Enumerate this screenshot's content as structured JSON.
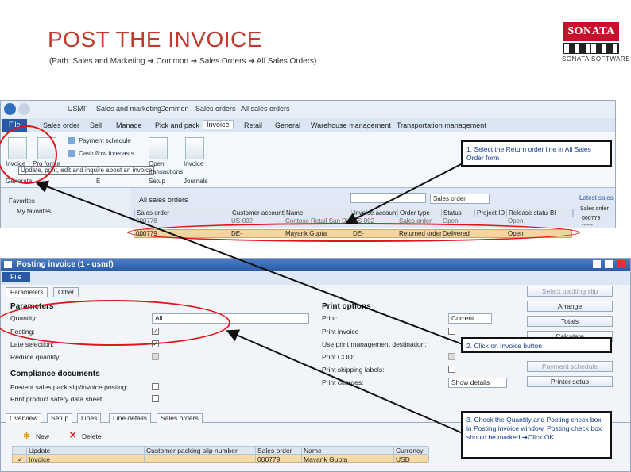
{
  "header": {
    "title": "POST THE INVOICE",
    "path_text": "(Path: Sales and Marketing ➔ Common ➔ Sales Orders ➔ All Sales Orders)"
  },
  "logo": {
    "name": "SONATA",
    "sub": "SONATA SOFTWARE"
  },
  "top_window": {
    "breadcrumb": [
      "USMF",
      "Sales and marketing",
      "Common",
      "Sales orders",
      "All sales orders"
    ],
    "ribbon_tabs": [
      "File",
      "Sales order",
      "Sell",
      "Manage",
      "Pick and pack",
      "Invoice",
      "Retail",
      "General",
      "Warehouse management",
      "Transportation management"
    ],
    "ribbon_buttons": {
      "invoice": "Invoice",
      "pro_forma": "Pro forma",
      "payment_schedule": "Payment schedule",
      "cash_flow": "Cash flow forecasts",
      "open_transactions": "Open transactions",
      "invoice_journal": "Invoice",
      "tooltip": "Update, print, edit and inquire about an invoice",
      "group_invoice": "Generate",
      "group_e": "E",
      "group_setup": "Setup",
      "group_journals": "Journals"
    },
    "nav": {
      "favorites": "Favorites",
      "my_favorites": "My favorites"
    },
    "list_title": "All sales orders",
    "filter_combo": "Sales order",
    "latest_sales": "Latest sales",
    "latest_sales_col": "Sales order",
    "latest_values": [
      "000779",
      "------"
    ],
    "columns": [
      "Sales order",
      "Customer account",
      "Name",
      "Invoice account",
      "Order type",
      "Status",
      "Project ID",
      "Release status",
      "Bl"
    ],
    "rows": [
      [
        "000778",
        "US-002",
        "Contoso Retail San Diego",
        "US-002",
        "Sales order",
        "Open",
        "",
        "Open",
        ""
      ],
      [
        "000779",
        "DE-",
        "Mayank Gupta",
        "DE-",
        "Returned order",
        "Delivered",
        "",
        "Open",
        ""
      ]
    ]
  },
  "posting_window": {
    "title": "Posting invoice (1 - usmf)",
    "menu_file": "File",
    "tabs": [
      "Parameters",
      "Other"
    ],
    "parameters": {
      "header": "Parameters",
      "quantity_label": "Quantity:",
      "quantity_value": "All",
      "posting_label": "Posting:",
      "late_selection_label": "Late selection:",
      "reduce_quantity_label": "Reduce quantity"
    },
    "compliance": {
      "header": "Compliance documents",
      "prevent_label": "Prevent sales pack slip/invoice posting:",
      "print_safety_label": "Print product safety data sheet:"
    },
    "print_options": {
      "header": "Print options",
      "print_label": "Print:",
      "print_value": "Current",
      "print_invoice_label": "Print invoice",
      "use_print_mgmt_label": "Use print management destination:",
      "print_cod_label": "Print COD:",
      "print_shipping_label": "Print shipping labels:",
      "print_charges_label": "Print charges:",
      "print_charges_value": "Show details"
    },
    "buttons": [
      "Select packing slip",
      "Arrange",
      "Totals",
      "Calculate",
      "Payment schedule",
      "Printer setup"
    ],
    "bottom_tabs": [
      "Overview",
      "Setup",
      "Lines",
      "Line details",
      "Sales orders"
    ],
    "new_label": "New",
    "delete_label": "Delete",
    "line_columns": [
      "Update",
      "Customer packing slip number",
      "Sales order",
      "Name",
      "Currency"
    ],
    "line_row": [
      "Invoice",
      "",
      "000779",
      "Mayank Gupta",
      "USD"
    ]
  },
  "callouts": {
    "c1": "1. Select the Return order line in All Sales Order form",
    "c2": "2.  Click on Invoice button",
    "c3": "3. Check the Quantity and Posting check box in Posting invoice window, Posting check box should be marked ➔Click OK"
  }
}
